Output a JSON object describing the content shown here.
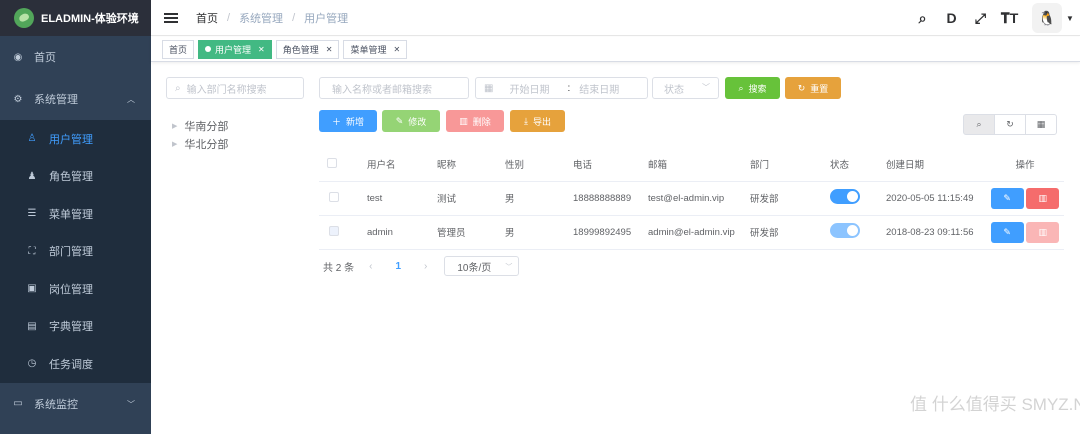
{
  "app": {
    "title": "ELADMIN-体验环境"
  },
  "sidebar": {
    "items": [
      {
        "label": "首页",
        "icon": "dashboard-icon",
        "glyph": "◉"
      },
      {
        "label": "系统管理",
        "icon": "gear-icon",
        "glyph": "⚙",
        "expanded": true,
        "children": [
          {
            "label": "用户管理",
            "icon": "user-icon",
            "glyph": "👤",
            "active": true
          },
          {
            "label": "角色管理",
            "icon": "role-icon",
            "glyph": "♟"
          },
          {
            "label": "菜单管理",
            "icon": "menu-icon",
            "glyph": "☰"
          },
          {
            "label": "部门管理",
            "icon": "dept-icon",
            "glyph": "⚲"
          },
          {
            "label": "岗位管理",
            "icon": "post-icon",
            "glyph": "▣"
          },
          {
            "label": "字典管理",
            "icon": "dict-icon",
            "glyph": "▤"
          },
          {
            "label": "任务调度",
            "icon": "timer-icon",
            "glyph": "◷"
          }
        ]
      },
      {
        "label": "系统监控",
        "icon": "monitor-icon",
        "glyph": "▭"
      }
    ]
  },
  "header": {
    "breadcrumb": [
      "首页",
      "系统管理",
      "用户管理"
    ],
    "icons": [
      "search-icon",
      "doc-icon",
      "fullscreen-icon",
      "font-size-icon"
    ]
  },
  "tags": [
    {
      "label": "首页",
      "active": false,
      "closable": false
    },
    {
      "label": "用户管理",
      "active": true,
      "closable": true
    },
    {
      "label": "角色管理",
      "active": false,
      "closable": true
    },
    {
      "label": "菜单管理",
      "active": false,
      "closable": true
    }
  ],
  "filters": {
    "dept_placeholder": "输入部门名称搜索",
    "user_placeholder": "输入名称或者邮箱搜索",
    "start_date_placeholder": "开始日期",
    "date_separator": ":",
    "end_date_placeholder": "结束日期",
    "status_placeholder": "状态",
    "search_label": "搜索",
    "reset_label": "重置"
  },
  "tree": [
    "华南分部",
    "华北分部"
  ],
  "actions": {
    "add": "新增",
    "edit": "修改",
    "delete": "删除",
    "export": "导出"
  },
  "colors": {
    "primary": "#409eff",
    "success": "#67c23a",
    "warning": "#e6a23c",
    "danger": "#f56c6c",
    "tag_active": "#42b983"
  },
  "table": {
    "columns": [
      "用户名",
      "昵称",
      "性别",
      "电话",
      "邮箱",
      "部门",
      "状态",
      "创建日期",
      "操作"
    ],
    "rows": [
      {
        "username": "test",
        "nickname": "测试",
        "gender": "男",
        "phone": "18888888889",
        "email": "test@el-admin.vip",
        "dept": "研发部",
        "enabled": true,
        "created": "2020-05-05 11:15:49"
      },
      {
        "username": "admin",
        "nickname": "管理员",
        "gender": "男",
        "phone": "18999892495",
        "email": "admin@el-admin.vip",
        "dept": "研发部",
        "enabled": true,
        "created": "2018-08-23 09:11:56"
      }
    ]
  },
  "pagination": {
    "total_text": "共 2 条",
    "current": "1",
    "page_size": "10条/页"
  },
  "watermark": "值 什么值得买 SMYZ.NET"
}
